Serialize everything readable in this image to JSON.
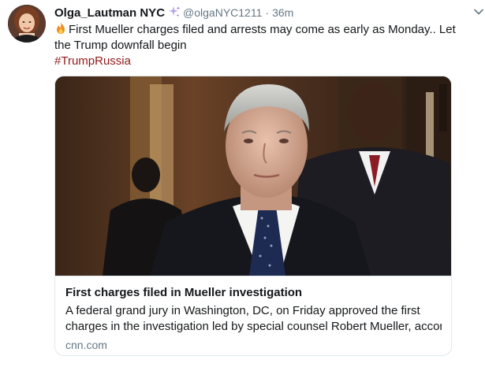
{
  "tweet": {
    "display_name": "Olga_Lautman NYC",
    "name_icon": "sparkles-icon",
    "handle": "@olgaNYC1211",
    "separator": "·",
    "time": "36m",
    "menu_icon": "chevron-down-icon",
    "lead_icon": "fire-icon",
    "text_line1": "First Mueller charges filed and arrests may come as early as Monday.. Let",
    "text_line2": "the Trump downfall begin",
    "hashtag": "#TrumpRussia"
  },
  "card": {
    "image_description_icon": "photo-icon",
    "title": "First charges filed in Mueller investigation",
    "description_line1": "A federal grand jury in Washington, DC, on Friday approved the first",
    "description_line2": "charges in the investigation led by special counsel Robert Mueller, accordi...",
    "domain": "cnn.com"
  },
  "colors": {
    "text": "#14171a",
    "secondary": "#657786",
    "hashtag": "#8f1a1a",
    "border": "#e1e8ed"
  }
}
